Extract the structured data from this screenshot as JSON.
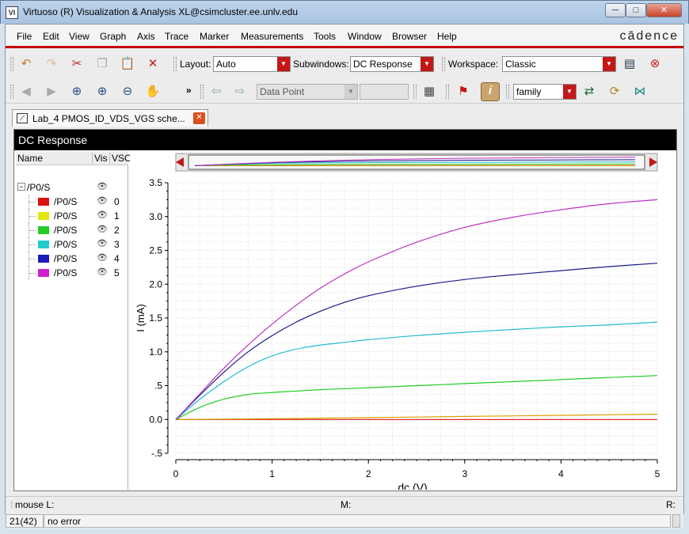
{
  "window": {
    "title": "Virtuoso (R) Visualization & Analysis XL@csimcluster.ee.unlv.edu",
    "min_label": "─",
    "max_label": "□",
    "close_label": "✕"
  },
  "menu": {
    "items": [
      "File",
      "Edit",
      "View",
      "Graph",
      "Axis",
      "Trace",
      "Marker",
      "Measurements",
      "Tools",
      "Window",
      "Browser",
      "Help"
    ],
    "brand": "cādence"
  },
  "toolbar1": {
    "layout_label": "Layout:",
    "layout_value": "Auto",
    "subwindows_label": "Subwindows:",
    "subwindows_value": "DC Response",
    "workspace_label": "Workspace:",
    "workspace_value": "Classic"
  },
  "toolbar2": {
    "overflow": "»",
    "data_point_value": "Data Point",
    "family_value": "family"
  },
  "tab": {
    "label": "Lab_4 PMOS_ID_VDS_VGS sche...",
    "close": "✕"
  },
  "panel": {
    "title": "DC Response"
  },
  "tree": {
    "col_name": "Name",
    "col_vis": "Vis",
    "col_vsc": "VSC",
    "root_label": "/P0/S",
    "items": [
      {
        "label": "/P0/S",
        "index": "0",
        "color": "#dd1010"
      },
      {
        "label": "/P0/S",
        "index": "1",
        "color": "#e4e40a"
      },
      {
        "label": "/P0/S",
        "index": "2",
        "color": "#22cc22"
      },
      {
        "label": "/P0/S",
        "index": "3",
        "color": "#22cccc"
      },
      {
        "label": "/P0/S",
        "index": "4",
        "color": "#1a1ab8"
      },
      {
        "label": "/P0/S",
        "index": "5",
        "color": "#d020d0"
      }
    ]
  },
  "chart_data": {
    "type": "line",
    "xlabel": "dc (V)",
    "ylabel": "I (mA)",
    "xlim": [
      0,
      5
    ],
    "ylim": [
      -0.5,
      3.5
    ],
    "x_ticks": [
      "0",
      "1",
      "2",
      "3",
      "4",
      "5"
    ],
    "y_ticks": [
      "-.5",
      "0.0",
      ".5",
      "1.0",
      "1.5",
      "2.0",
      "2.5",
      "3.0",
      "3.5"
    ],
    "grid": true,
    "x": [
      0,
      0.25,
      0.5,
      0.75,
      1.0,
      1.25,
      1.5,
      1.75,
      2.0,
      2.5,
      3.0,
      3.5,
      4.0,
      4.5,
      5.0
    ],
    "series": [
      {
        "name": "0",
        "color": "#dd1010",
        "values": [
          0,
          0,
          0,
          0,
          0,
          0,
          0,
          0,
          0,
          0,
          0,
          0,
          0,
          0,
          0
        ]
      },
      {
        "name": "1",
        "color": "#d8a000",
        "values": [
          0,
          0.002,
          0.005,
          0.008,
          0.012,
          0.016,
          0.02,
          0.024,
          0.028,
          0.036,
          0.045,
          0.053,
          0.061,
          0.07,
          0.078
        ]
      },
      {
        "name": "2",
        "color": "#22cc22",
        "values": [
          0,
          0.18,
          0.3,
          0.37,
          0.4,
          0.42,
          0.44,
          0.455,
          0.47,
          0.5,
          0.53,
          0.56,
          0.59,
          0.62,
          0.65
        ]
      },
      {
        "name": "3",
        "color": "#22bbcc",
        "values": [
          0,
          0.3,
          0.56,
          0.78,
          0.94,
          1.04,
          1.1,
          1.14,
          1.18,
          1.24,
          1.29,
          1.33,
          1.37,
          1.4,
          1.44
        ]
      },
      {
        "name": "4",
        "color": "#1a1a8a",
        "values": [
          0,
          0.36,
          0.7,
          1.0,
          1.24,
          1.44,
          1.6,
          1.73,
          1.83,
          1.97,
          2.07,
          2.14,
          2.2,
          2.26,
          2.31
        ]
      },
      {
        "name": "5",
        "color": "#c030c0",
        "values": [
          0,
          0.38,
          0.76,
          1.1,
          1.41,
          1.69,
          1.94,
          2.15,
          2.33,
          2.62,
          2.84,
          2.99,
          3.1,
          3.19,
          3.25
        ]
      }
    ]
  },
  "status": {
    "mouse_l": "mouse L:",
    "mouse_m": "M:",
    "mouse_r": "R:",
    "count": "21(42)",
    "message": "no error"
  }
}
